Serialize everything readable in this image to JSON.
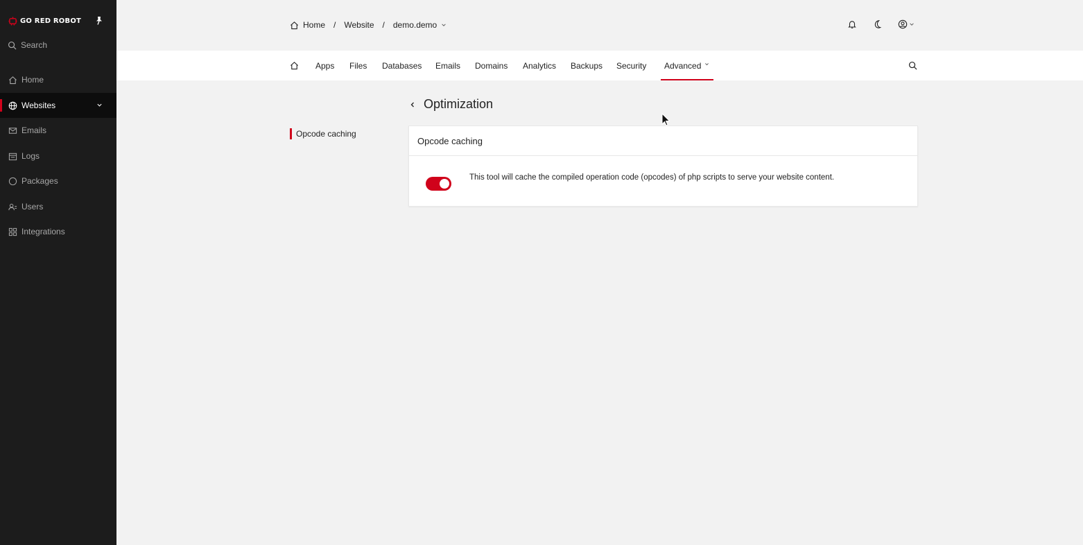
{
  "brand": {
    "name": "GO RED ROBOT",
    "accent": "#d0021b"
  },
  "sidebar": {
    "search_label": "Search",
    "items": [
      {
        "label": "Home",
        "icon": "home-icon"
      },
      {
        "label": "Websites",
        "icon": "globe-icon",
        "active": true
      },
      {
        "label": "Emails",
        "icon": "mail-icon"
      },
      {
        "label": "Logs",
        "icon": "calendar-icon"
      },
      {
        "label": "Packages",
        "icon": "circle-icon"
      },
      {
        "label": "Users",
        "icon": "users-icon"
      },
      {
        "label": "Integrations",
        "icon": "grid-icon"
      }
    ]
  },
  "breadcrumb": {
    "home": "Home",
    "separator": "/",
    "section": "Website",
    "site": "demo.demo"
  },
  "tabs": [
    {
      "label": "Apps"
    },
    {
      "label": "Files"
    },
    {
      "label": "Databases"
    },
    {
      "label": "Emails"
    },
    {
      "label": "Domains"
    },
    {
      "label": "Analytics"
    },
    {
      "label": "Backups"
    },
    {
      "label": "Security"
    },
    {
      "label": "Advanced",
      "active": true
    }
  ],
  "page": {
    "title": "Optimization",
    "subnav_item": "Opcode caching"
  },
  "card": {
    "title": "Opcode caching",
    "toggle_on": true,
    "description": "This tool will cache the compiled operation code (opcodes) of php scripts to serve your website content."
  }
}
